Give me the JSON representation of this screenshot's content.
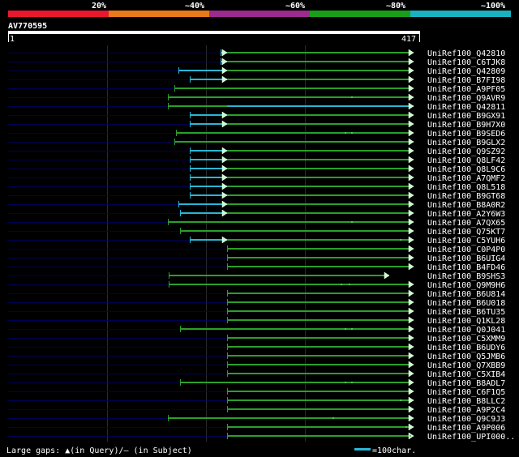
{
  "identity_scale": {
    "labels": [
      "20%",
      "~40%",
      "~60%",
      "~80%",
      "~100%"
    ],
    "colors": [
      "#e8192c",
      "#e87a1a",
      "#9b2b8e",
      "#1a9e1a",
      "#19b2c0"
    ]
  },
  "query": {
    "id": "AV770595",
    "start_label": "1",
    "end_label": "417",
    "length": 417
  },
  "colors": {
    "query_track": "#000055",
    "cyan_segment": "#29b6d6",
    "green_segment": "#2aa02a",
    "arrow_fill": "#c8ffc8"
  },
  "hits": [
    {
      "name": "UniRef100_Q42810",
      "track_start": 0,
      "cyan": [
        272,
        280
      ],
      "green": [
        280,
        510
      ],
      "gap": null,
      "arrow": true,
      "dots": []
    },
    {
      "name": "UniRef100_C6TJK8",
      "track_start": 0,
      "cyan": [
        272,
        280
      ],
      "green": [
        280,
        510
      ],
      "gap": null,
      "arrow": true,
      "dots": []
    },
    {
      "name": "UniRef100_Q42809",
      "track_start": 0,
      "cyan": [
        220,
        280
      ],
      "green": [
        280,
        510
      ],
      "gap": null,
      "arrow": true,
      "dots": []
    },
    {
      "name": "UniRef100_B7FI98",
      "track_start": 0,
      "cyan": [
        234,
        280
      ],
      "green": [
        280,
        510
      ],
      "gap": null,
      "arrow": true,
      "dots": []
    },
    {
      "name": "UniRef100_A9PF05",
      "track_start": 0,
      "cyan": null,
      "green": [
        215,
        510
      ],
      "gap": null,
      "arrow": true,
      "dots": []
    },
    {
      "name": "UniRef100_Q9AVR9",
      "track_start": 0,
      "cyan": null,
      "green": [
        207,
        510
      ],
      "gap": null,
      "arrow": true,
      "dots": [
        433
      ]
    },
    {
      "name": "UniRef100_Q42811",
      "track_start": 0,
      "cyan": [
        280,
        510
      ],
      "green": [
        207,
        280
      ],
      "gap": null,
      "arrow": true,
      "dots": []
    },
    {
      "name": "UniRef100_B9GX91",
      "track_start": 0,
      "cyan": [
        234,
        280
      ],
      "green": [
        280,
        510
      ],
      "gap": null,
      "arrow": true,
      "dots": []
    },
    {
      "name": "UniRef100_B9H7X0",
      "track_start": 0,
      "cyan": [
        234,
        280
      ],
      "green": [
        280,
        510
      ],
      "gap": null,
      "arrow": true,
      "dots": []
    },
    {
      "name": "UniRef100_B9SED6",
      "track_start": 0,
      "cyan": null,
      "green": [
        217,
        510
      ],
      "gap": null,
      "arrow": true,
      "dots": [
        425,
        433
      ]
    },
    {
      "name": "UniRef100_B9GLX2",
      "track_start": 0,
      "cyan": null,
      "green": [
        215,
        510
      ],
      "gap": null,
      "arrow": true,
      "dots": []
    },
    {
      "name": "UniRef100_Q9SZ92",
      "track_start": 0,
      "cyan": [
        234,
        280
      ],
      "green": [
        280,
        510
      ],
      "gap": null,
      "arrow": true,
      "dots": []
    },
    {
      "name": "UniRef100_Q8LF42",
      "track_start": 0,
      "cyan": [
        234,
        280
      ],
      "green": [
        280,
        510
      ],
      "gap": null,
      "arrow": true,
      "dots": []
    },
    {
      "name": "UniRef100_Q8L9C6",
      "track_start": 0,
      "cyan": [
        234,
        280
      ],
      "green": [
        280,
        510
      ],
      "gap": null,
      "arrow": true,
      "dots": []
    },
    {
      "name": "UniRef100_A7QMF2",
      "track_start": 0,
      "cyan": [
        234,
        280
      ],
      "green": [
        280,
        510
      ],
      "gap": null,
      "arrow": true,
      "dots": []
    },
    {
      "name": "UniRef100_Q8L518",
      "track_start": 0,
      "cyan": [
        234,
        280
      ],
      "green": [
        280,
        510
      ],
      "gap": null,
      "arrow": true,
      "dots": []
    },
    {
      "name": "UniRef100_B9GT68",
      "track_start": 0,
      "cyan": [
        234,
        280
      ],
      "green": [
        280,
        510
      ],
      "gap": null,
      "arrow": true,
      "dots": []
    },
    {
      "name": "UniRef100_B8A0R2",
      "track_start": 0,
      "cyan": [
        220,
        280
      ],
      "green": [
        280,
        510
      ],
      "gap": null,
      "arrow": true,
      "dots": []
    },
    {
      "name": "UniRef100_A2Y6W3",
      "track_start": 0,
      "cyan": [
        222,
        280
      ],
      "green": [
        280,
        510
      ],
      "gap": null,
      "arrow": true,
      "dots": []
    },
    {
      "name": "UniRef100_A7QX65",
      "track_start": 0,
      "cyan": null,
      "green": [
        207,
        510
      ],
      "gap": null,
      "arrow": true,
      "dots": [
        433
      ]
    },
    {
      "name": "UniRef100_Q75KT7",
      "track_start": 0,
      "cyan": null,
      "green": [
        222,
        510
      ],
      "gap": null,
      "arrow": true,
      "dots": []
    },
    {
      "name": "UniRef100_C5YUH6",
      "track_start": 0,
      "cyan": [
        234,
        280
      ],
      "green": [
        280,
        510
      ],
      "gap": null,
      "arrow": true,
      "dots": [
        493
      ]
    },
    {
      "name": "UniRef100_C0P4P0",
      "track_start": 0,
      "cyan": null,
      "green": [
        280,
        510
      ],
      "gap": null,
      "arrow": true,
      "dots": []
    },
    {
      "name": "UniRef100_B6UIG4",
      "track_start": 0,
      "cyan": null,
      "green": [
        280,
        510
      ],
      "gap": null,
      "arrow": true,
      "dots": []
    },
    {
      "name": "UniRef100_B4FD46",
      "track_start": 0,
      "cyan": null,
      "green": [
        280,
        510
      ],
      "gap": null,
      "arrow": true,
      "dots": []
    },
    {
      "name": "UniRef100_B9SHS3",
      "track_start": 0,
      "cyan": null,
      "green": [
        208,
        480
      ],
      "gap": null,
      "arrow": true,
      "dots": []
    },
    {
      "name": "UniRef100_Q9M9H6",
      "track_start": 0,
      "cyan": null,
      "green": [
        208,
        510
      ],
      "gap": null,
      "arrow": true,
      "dots": [
        420,
        430
      ]
    },
    {
      "name": "UniRef100_B6U814",
      "track_start": 0,
      "cyan": null,
      "green": [
        280,
        510
      ],
      "gap": null,
      "arrow": true,
      "dots": []
    },
    {
      "name": "UniRef100_B6U018",
      "track_start": 0,
      "cyan": null,
      "green": [
        280,
        510
      ],
      "gap": null,
      "arrow": true,
      "dots": []
    },
    {
      "name": "UniRef100_B6TU35",
      "track_start": 0,
      "cyan": null,
      "green": [
        280,
        510
      ],
      "gap": null,
      "arrow": true,
      "dots": []
    },
    {
      "name": "UniRef100_Q1KL28",
      "track_start": 0,
      "cyan": null,
      "green": [
        280,
        510
      ],
      "gap": null,
      "arrow": true,
      "dots": []
    },
    {
      "name": "UniRef100_Q0J041",
      "track_start": 0,
      "cyan": null,
      "green": [
        222,
        510
      ],
      "gap": null,
      "arrow": true,
      "dots": [
        425,
        433
      ]
    },
    {
      "name": "UniRef100_C5XMM9",
      "track_start": 0,
      "cyan": null,
      "green": [
        280,
        510
      ],
      "gap": null,
      "arrow": true,
      "dots": []
    },
    {
      "name": "UniRef100_B6UDY6",
      "track_start": 0,
      "cyan": null,
      "green": [
        280,
        510
      ],
      "gap": null,
      "arrow": true,
      "dots": []
    },
    {
      "name": "UniRef100_Q5JMB6",
      "track_start": 0,
      "cyan": null,
      "green": [
        280,
        510
      ],
      "gap": null,
      "arrow": true,
      "dots": []
    },
    {
      "name": "UniRef100_Q7XBB9",
      "track_start": 0,
      "cyan": null,
      "green": [
        280,
        510
      ],
      "gap": null,
      "arrow": true,
      "dots": []
    },
    {
      "name": "UniRef100_C5XIB4",
      "track_start": 0,
      "cyan": null,
      "green": [
        280,
        510
      ],
      "gap": null,
      "arrow": true,
      "dots": []
    },
    {
      "name": "UniRef100_B8ADL7",
      "track_start": 0,
      "cyan": null,
      "green": [
        222,
        510
      ],
      "gap": null,
      "arrow": true,
      "dots": [
        425,
        433
      ]
    },
    {
      "name": "UniRef100_C6F1Q5",
      "track_start": 0,
      "cyan": null,
      "green": [
        280,
        510
      ],
      "gap": null,
      "arrow": true,
      "dots": []
    },
    {
      "name": "UniRef100_B8LLC2",
      "track_start": 0,
      "cyan": null,
      "green": [
        280,
        510
      ],
      "gap": null,
      "arrow": true,
      "dots": [
        493
      ]
    },
    {
      "name": "UniRef100_A9P2C4",
      "track_start": 0,
      "cyan": null,
      "green": [
        280,
        510
      ],
      "gap": null,
      "arrow": true,
      "dots": []
    },
    {
      "name": "UniRef100_Q9C9J3",
      "track_start": 0,
      "cyan": null,
      "green": [
        207,
        510
      ],
      "gap": null,
      "arrow": true,
      "dots": [
        410
      ]
    },
    {
      "name": "UniRef100_A9P006",
      "track_start": 0,
      "cyan": null,
      "green": [
        280,
        510
      ],
      "gap": null,
      "arrow": true,
      "dots": [
        500
      ]
    },
    {
      "name": "UniRef100_UPI000..",
      "track_start": 0,
      "cyan": null,
      "green": [
        280,
        510
      ],
      "gap": null,
      "arrow": true,
      "dots": [
        505
      ]
    }
  ],
  "footer": {
    "gaps_text": "Large gaps: ▲(in Query)/– (in Subject)",
    "scale_text": "=100char."
  }
}
